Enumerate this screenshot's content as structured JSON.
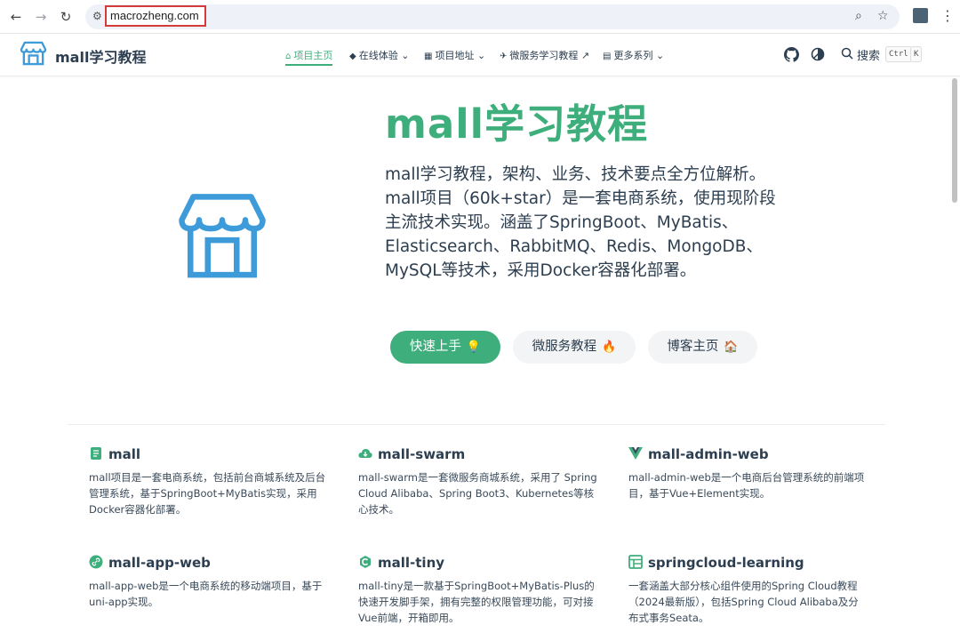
{
  "browser": {
    "url": "macrozheng.com",
    "back_glyph": "←",
    "forward_glyph": "→",
    "reload_glyph": "↻",
    "zoom_glyph": "⌕",
    "star_glyph": "☆",
    "menu_glyph": "⋮",
    "tune_glyph": "⚙"
  },
  "navbar": {
    "site_title": "mall学习教程",
    "items": [
      {
        "icon": "⌂",
        "label": "项目主页",
        "active": true
      },
      {
        "icon": "◆",
        "label": "在线体验 ⌄"
      },
      {
        "icon": "▦",
        "label": "项目地址 ⌄"
      },
      {
        "icon": "✈",
        "label": "微服务学习教程 ↗"
      },
      {
        "icon": "▤",
        "label": "更多系列 ⌄"
      }
    ],
    "search_label": "搜索",
    "search_kbd_1": "Ctrl",
    "search_kbd_2": "K"
  },
  "hero": {
    "title": "mall学习教程",
    "description": "mall学习教程，架构、业务、技术要点全方位解析。mall项目（60k+star）是一套电商系统，使用现阶段主流技术实现。涵盖了SpringBoot、MyBatis、Elasticsearch、RabbitMQ、Redis、MongoDB、MySQL等技术，采用Docker容器化部署。",
    "buttons": [
      {
        "label": "快速上手",
        "emoji": "💡"
      },
      {
        "label": "微服务教程",
        "emoji": "🔥"
      },
      {
        "label": "博客主页",
        "emoji": "🏠"
      }
    ]
  },
  "features": [
    {
      "title": "mall",
      "desc": "mall项目是一套电商系统，包括前台商城系统及后台管理系统，基于SpringBoot+MyBatis实现，采用Docker容器化部署。"
    },
    {
      "title": "mall-swarm",
      "desc": "mall-swarm是一套微服务商城系统，采用了 Spring Cloud Alibaba、Spring Boot3、Kubernetes等核心技术。"
    },
    {
      "title": "mall-admin-web",
      "desc": "mall-admin-web是一个电商后台管理系统的前端项目，基于Vue+Element实现。"
    },
    {
      "title": "mall-app-web",
      "desc": "mall-app-web是一个电商系统的移动端项目，基于uni-app实现。"
    },
    {
      "title": "mall-tiny",
      "desc": "mall-tiny是一款基于SpringBoot+MyBatis-Plus的快速开发脚手架，拥有完整的权限管理功能，可对接Vue前端，开箱即用。"
    },
    {
      "title": "springcloud-learning",
      "desc": "一套涵盖大部分核心组件使用的Spring Cloud教程（2024最新版），包括Spring Cloud Alibaba及分布式事务Seata。"
    }
  ],
  "colors": {
    "accent": "#3eaf7c",
    "logo_blue": "#3e9bd9",
    "text": "#2c3e50"
  }
}
